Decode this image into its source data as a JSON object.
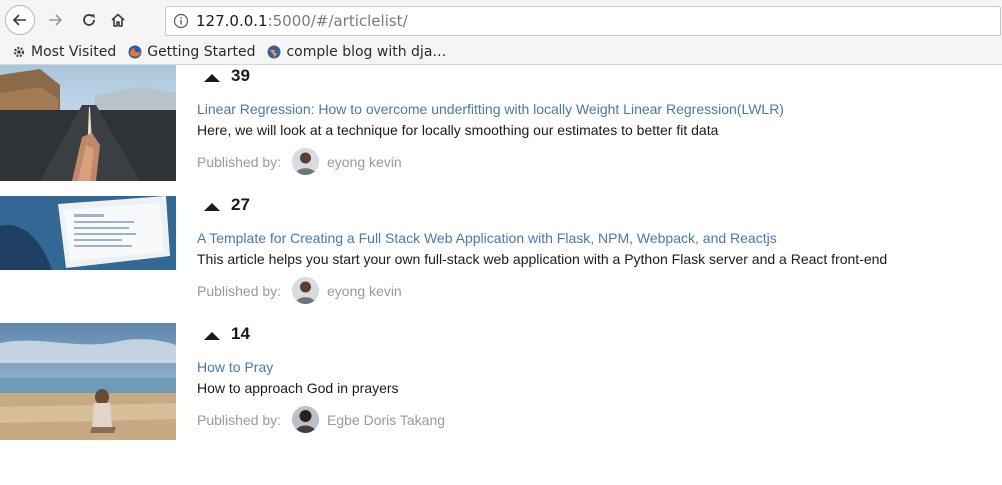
{
  "browser": {
    "url_host": "127.0.0.1",
    "url_rest": ":5000/#/articlelist/",
    "icons": {
      "back": "back-arrow-icon",
      "forward": "forward-arrow-icon",
      "reload": "reload-icon",
      "home": "home-icon",
      "info": "info-icon"
    }
  },
  "bookmarks": [
    {
      "label": "Most Visited",
      "icon": "gear-icon"
    },
    {
      "label": "Getting Started",
      "icon": "firefox-icon"
    },
    {
      "label": "comple blog with dja…",
      "icon": "globe-icon"
    }
  ],
  "articles": [
    {
      "votes": "39",
      "title": "Linear Regression: How to overcome underfitting with locally Weight Linear Regression(LWLR)",
      "description": "Here, we will look at a technique for locally smoothing our estimates to better fit data",
      "published_label": "Published by:",
      "author": "eyong kevin"
    },
    {
      "votes": "27",
      "title": "A Template for Creating a Full Stack Web Application with Flask, NPM, Webpack, and Reactjs",
      "description": "This article helps you start your own full-stack web application with a Python Flask server and a React front-end",
      "published_label": "Published by:",
      "author": "eyong kevin"
    },
    {
      "votes": "14",
      "title": "How to Pray",
      "description": "How to approach God in prayers",
      "published_label": "Published by:",
      "author": "Egbe Doris Takang"
    }
  ]
}
